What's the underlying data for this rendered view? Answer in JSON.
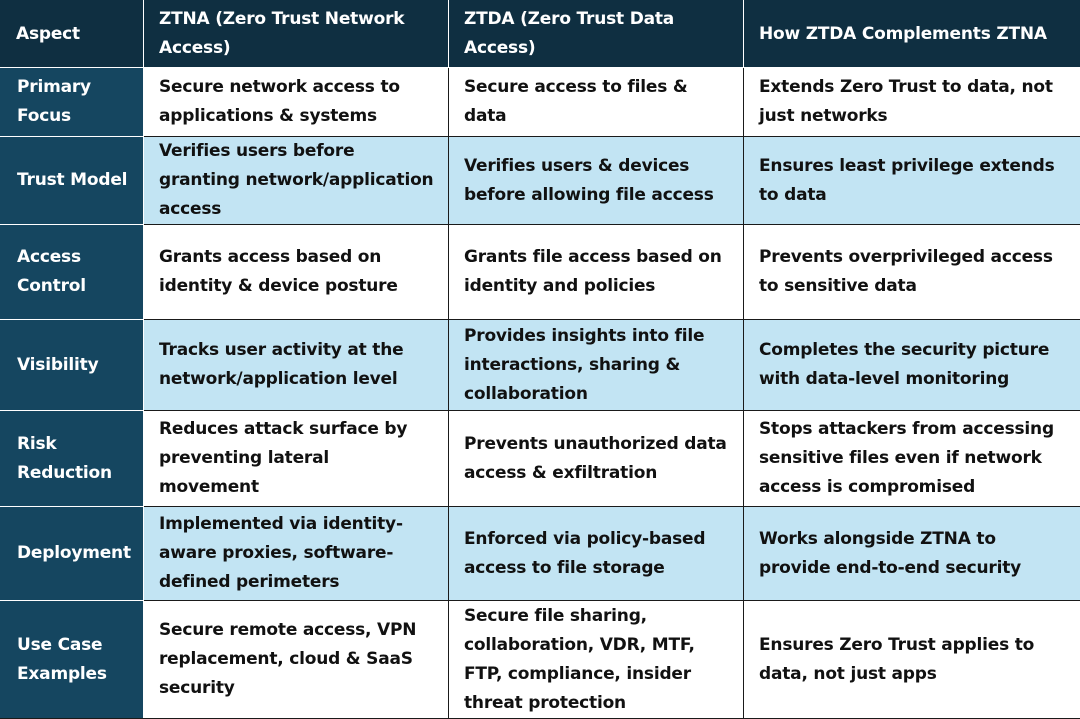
{
  "table": {
    "headers": [
      "Aspect",
      "ZTNA (Zero Trust Network Access)",
      "ZTDA (Zero Trust Data Access)",
      "How ZTDA Complements ZTNA"
    ],
    "rows": [
      {
        "aspect": "Primary Focus",
        "ztna": "Secure network access to applications & systems",
        "ztda": "Secure access to files & data",
        "complement": "Extends Zero Trust to data, not just networks"
      },
      {
        "aspect": "Trust Model",
        "ztna": "Verifies users before granting network/application access",
        "ztda": "Verifies users & devices before allowing file access",
        "complement": "Ensures least privilege extends to data"
      },
      {
        "aspect": "Access Control",
        "ztna": "Grants access based on identity & device posture",
        "ztda": "Grants file access based on identity and policies",
        "complement": "Prevents overprivileged access to sensitive data"
      },
      {
        "aspect": "Visibility",
        "ztna": "Tracks user activity at the network/application level",
        "ztda": "Provides insights into file interactions, sharing & collaboration",
        "complement": "Completes the security picture with data-level monitoring"
      },
      {
        "aspect": "Risk Reduction",
        "ztna": "Reduces attack surface by preventing lateral movement",
        "ztda": "Prevents unauthorized data access & exfiltration",
        "complement": "Stops attackers from accessing sensitive files even if network access is compromised"
      },
      {
        "aspect": "Deployment",
        "ztna": "Implemented via identity-aware proxies, software-defined perimeters",
        "ztda": "Enforced via policy-based access to file storage",
        "complement": "Works alongside ZTNA to provide end-to-end security"
      },
      {
        "aspect": "Use Case Examples",
        "ztna": "Secure remote access, VPN replacement, cloud & SaaS security",
        "ztda": "Secure file sharing, collaboration, VDR, MTF, FTP, compliance, insider threat protection",
        "complement": "Ensures Zero Trust applies to data, not just apps"
      }
    ]
  },
  "colors": {
    "header_bg": "#0f2f41",
    "aspect_bg": "#154660",
    "row_alt_bg": "#c2e4f3",
    "row_bg": "#ffffff",
    "text_dark": "#111111",
    "text_light": "#ffffff"
  }
}
